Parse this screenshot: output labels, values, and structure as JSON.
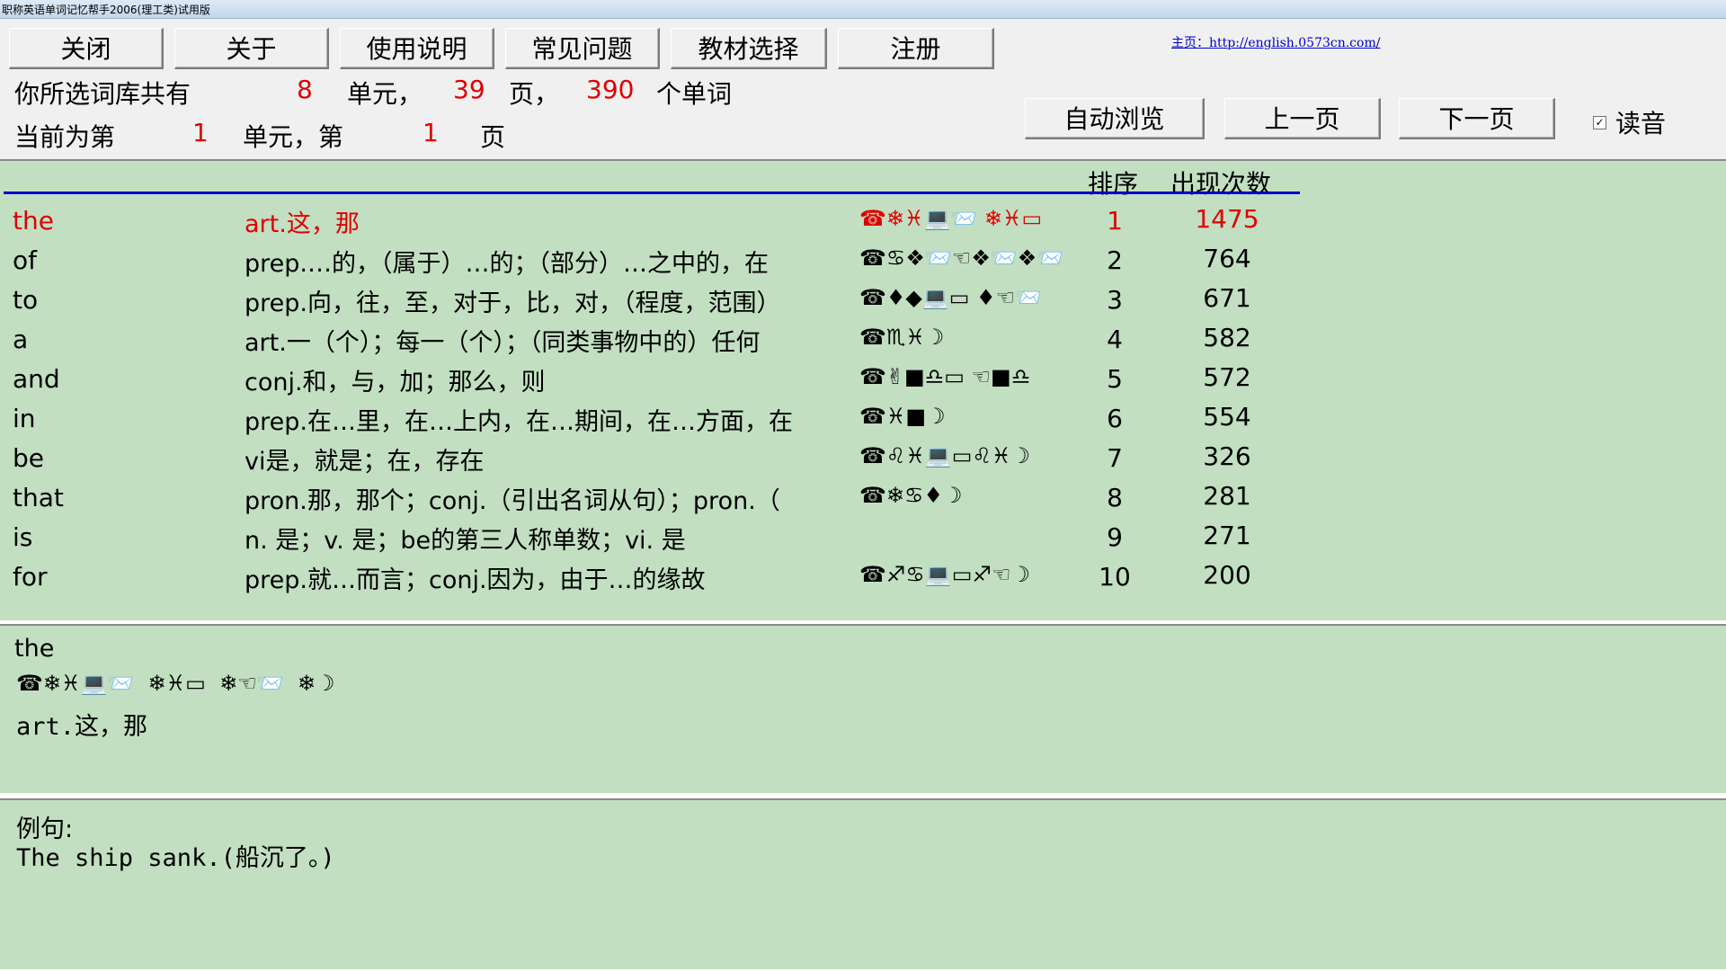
{
  "window": {
    "title": "职称英语单词记忆帮手2006(理工类)试用版"
  },
  "toolbar": {
    "buttons": [
      "关闭",
      "关于",
      "使用说明",
      "常见问题",
      "教材选择",
      "注册"
    ],
    "homepage_link": "主页：http://english.0573cn.com/"
  },
  "summary": {
    "prefix": "你所选词库共有",
    "units": "8",
    "units_label": "单元，",
    "pages": "39",
    "pages_label": "页，",
    "words": "390",
    "words_label": "个单词"
  },
  "current": {
    "prefix": "当前为第",
    "unit": "1",
    "unit_label": "单元，第",
    "page": "1",
    "page_label": "页"
  },
  "nav": {
    "auto_browse": "自动浏览",
    "prev_page": "上一页",
    "next_page": "下一页",
    "read_aloud_label": "读音",
    "read_aloud_checked": true
  },
  "list": {
    "headers": {
      "rank": "排序",
      "count": "出现次数"
    },
    "selected_index": 0,
    "rows": [
      {
        "word": "the",
        "meaning": "art.这，那",
        "phonetic": "☎❄♓💻📨 ❄♓▭",
        "rank": "1",
        "count": "1475"
      },
      {
        "word": "of",
        "meaning": "prep.…的，（属于）…的；（部分）…之中的，在",
        "phonetic": "☎♋❖📨☜❖📨❖📨",
        "rank": "2",
        "count": "764"
      },
      {
        "word": "to",
        "meaning": "prep.向，往，至，对于，比，对，（程度，范围）",
        "phonetic": "☎♦◆💻▭ ♦☜📨",
        "rank": "3",
        "count": "671"
      },
      {
        "word": "a",
        "meaning": "art.一（个）；每一（个）；（同类事物中的）任何",
        "phonetic": "☎♏♓☽",
        "rank": "4",
        "count": "582"
      },
      {
        "word": "and",
        "meaning": "conj.和，与，加；那么，则",
        "phonetic": "☎✌■♎▭ ☜■♎",
        "rank": "5",
        "count": "572"
      },
      {
        "word": "in",
        "meaning": "prep.在…里，在…上内，在…期间，在…方面，在",
        "phonetic": "☎♓■☽",
        "rank": "6",
        "count": "554"
      },
      {
        "word": "be",
        "meaning": "vi是，就是；在，存在",
        "phonetic": "☎♌♓💻▭♌♓☽",
        "rank": "7",
        "count": "326"
      },
      {
        "word": "that",
        "meaning": "pron.那，那个；conj.（引出名词从句）；pron.（",
        "phonetic": "☎❄♋♦☽",
        "rank": "8",
        "count": "281"
      },
      {
        "word": "is",
        "meaning": "n. 是；v. 是；be的第三人称单数；vi. 是",
        "phonetic": "",
        "rank": "9",
        "count": "271"
      },
      {
        "word": "for",
        "meaning": "prep.就…而言；conj.因为，由于…的缘故",
        "phonetic": "☎♐♋💻▭♐☜☽",
        "rank": "10",
        "count": "200"
      }
    ]
  },
  "detail": {
    "word": "the",
    "phonetic": "☎❄♓💻📨  ❄♓▭  ❄☜📨  ❄☽",
    "meaning": "art.这，那"
  },
  "example": {
    "label": "例句:",
    "text": "The ship sank.(船沉了。)"
  }
}
